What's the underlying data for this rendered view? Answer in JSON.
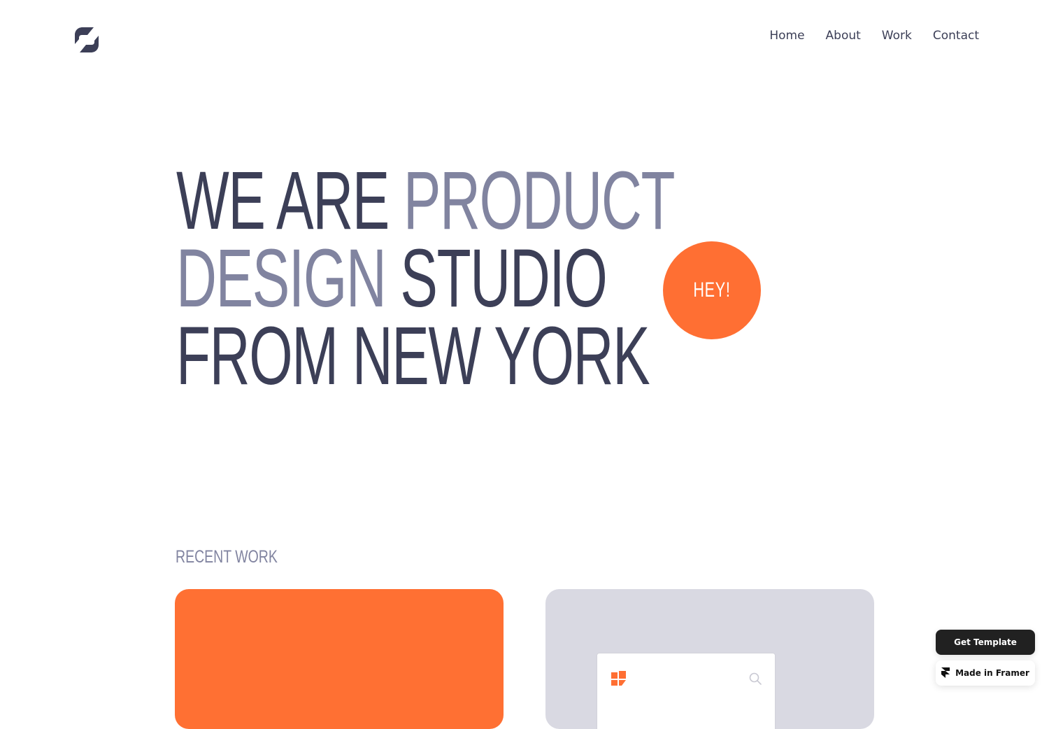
{
  "header": {
    "logo_icon": "studio-logo-icon",
    "nav": [
      {
        "label": "Home"
      },
      {
        "label": "About"
      },
      {
        "label": "Work"
      },
      {
        "label": "Contact"
      }
    ]
  },
  "hero": {
    "line1_plain": "WE ARE ",
    "line1_accent": "PRODUCT",
    "line2_accent": "DESIGN ",
    "line2_plain": "STUDIO",
    "line3_plain": "FROM NEW YORK",
    "badge_label": "HEY!"
  },
  "recent_work": {
    "title": "RECENT WORK",
    "cards": [
      {
        "color": "#ff7033"
      },
      {
        "color": "#d9d9e2",
        "window_logo_icon": "orange-grid-logo-icon",
        "window_search_icon": "search-icon"
      }
    ]
  },
  "framer_badges": {
    "get_template": "Get Template",
    "made_in_framer": "Made in Framer",
    "framer_icon": "framer-icon"
  },
  "colors": {
    "text_dark": "#3c3f57",
    "text_accent": "#8184a0",
    "orange": "#ff6f33",
    "card_gray": "#d9d9e2"
  }
}
